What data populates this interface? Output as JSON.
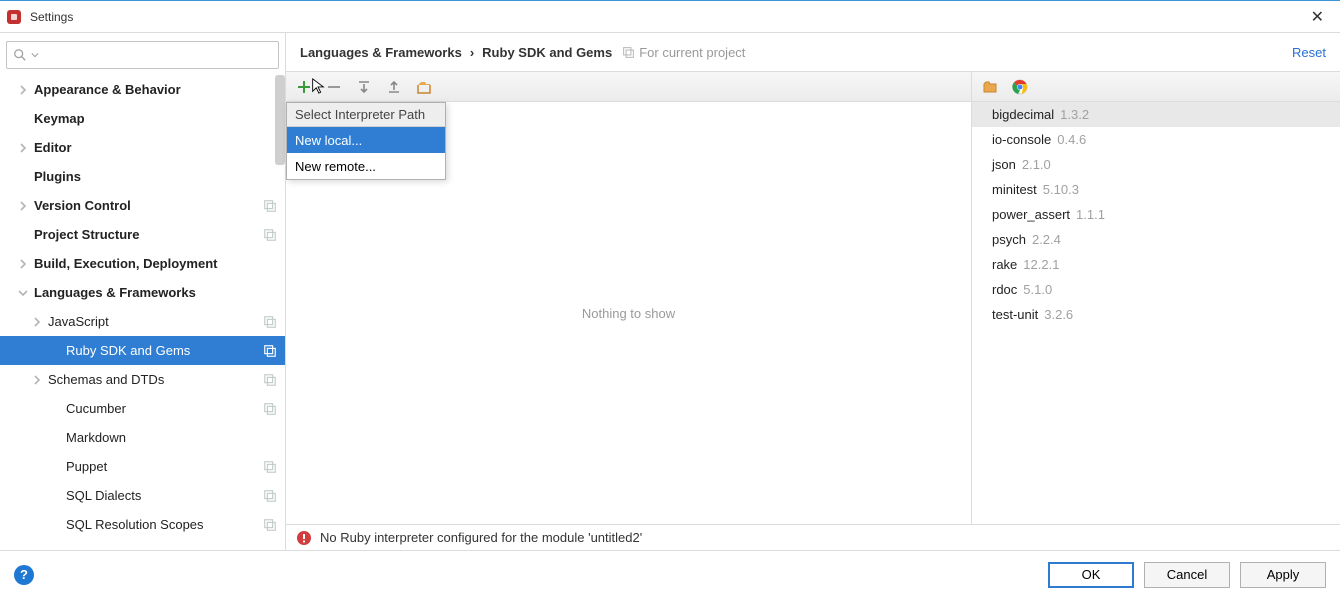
{
  "window": {
    "title": "Settings",
    "close_glyph": "✕"
  },
  "search": {
    "placeholder": ""
  },
  "sidebar": [
    {
      "pad": 0,
      "chev": "right",
      "bold": true,
      "label": "Appearance & Behavior",
      "copy": false
    },
    {
      "pad": 0,
      "chev": "blank",
      "bold": true,
      "label": "Keymap",
      "copy": false
    },
    {
      "pad": 0,
      "chev": "right",
      "bold": true,
      "label": "Editor",
      "copy": false
    },
    {
      "pad": 0,
      "chev": "blank",
      "bold": true,
      "label": "Plugins",
      "copy": false
    },
    {
      "pad": 0,
      "chev": "right",
      "bold": true,
      "label": "Version Control",
      "copy": true
    },
    {
      "pad": 0,
      "chev": "blank",
      "bold": true,
      "label": "Project Structure",
      "copy": true
    },
    {
      "pad": 0,
      "chev": "right",
      "bold": true,
      "label": "Build, Execution, Deployment",
      "copy": false
    },
    {
      "pad": 0,
      "chev": "down",
      "bold": true,
      "label": "Languages & Frameworks",
      "copy": false
    },
    {
      "pad": 1,
      "chev": "right",
      "bold": false,
      "label": "JavaScript",
      "copy": true
    },
    {
      "pad": 2,
      "chev": "blank",
      "bold": false,
      "label": "Ruby SDK and Gems",
      "copy": true,
      "selected": true
    },
    {
      "pad": 1,
      "chev": "right",
      "bold": false,
      "label": "Schemas and DTDs",
      "copy": true
    },
    {
      "pad": 2,
      "chev": "blank",
      "bold": false,
      "label": "Cucumber",
      "copy": true
    },
    {
      "pad": 2,
      "chev": "blank",
      "bold": false,
      "label": "Markdown",
      "copy": false
    },
    {
      "pad": 2,
      "chev": "blank",
      "bold": false,
      "label": "Puppet",
      "copy": true
    },
    {
      "pad": 2,
      "chev": "blank",
      "bold": false,
      "label": "SQL Dialects",
      "copy": true
    },
    {
      "pad": 2,
      "chev": "blank",
      "bold": false,
      "label": "SQL Resolution Scopes",
      "copy": true
    }
  ],
  "breadcrumb": {
    "a": "Languages & Frameworks",
    "sep": "›",
    "b": "Ruby SDK and Gems",
    "proj": "For current project",
    "reset": "Reset"
  },
  "toolbar_icons": [
    "plus-icon",
    "minus-icon",
    "move-down-icon",
    "move-up-icon",
    "edit-paths-icon"
  ],
  "right_toolbar_icons": [
    "folder-icon",
    "chrome-icon"
  ],
  "empty_text": "Nothing to show",
  "dropdown": {
    "title": "Select Interpreter Path",
    "items": [
      {
        "label": "New local...",
        "selected": true
      },
      {
        "label": "New remote...",
        "selected": false
      }
    ]
  },
  "gems": [
    {
      "name": "bigdecimal",
      "ver": "1.3.2",
      "selected": true
    },
    {
      "name": "io-console",
      "ver": "0.4.6"
    },
    {
      "name": "json",
      "ver": "2.1.0"
    },
    {
      "name": "minitest",
      "ver": "5.10.3"
    },
    {
      "name": "power_assert",
      "ver": "1.1.1"
    },
    {
      "name": "psych",
      "ver": "2.2.4"
    },
    {
      "name": "rake",
      "ver": "12.2.1"
    },
    {
      "name": "rdoc",
      "ver": "5.1.0"
    },
    {
      "name": "test-unit",
      "ver": "3.2.6"
    }
  ],
  "status": "No Ruby interpreter configured for the module 'untitled2'",
  "footer": {
    "ok": "OK",
    "cancel": "Cancel",
    "apply": "Apply"
  }
}
